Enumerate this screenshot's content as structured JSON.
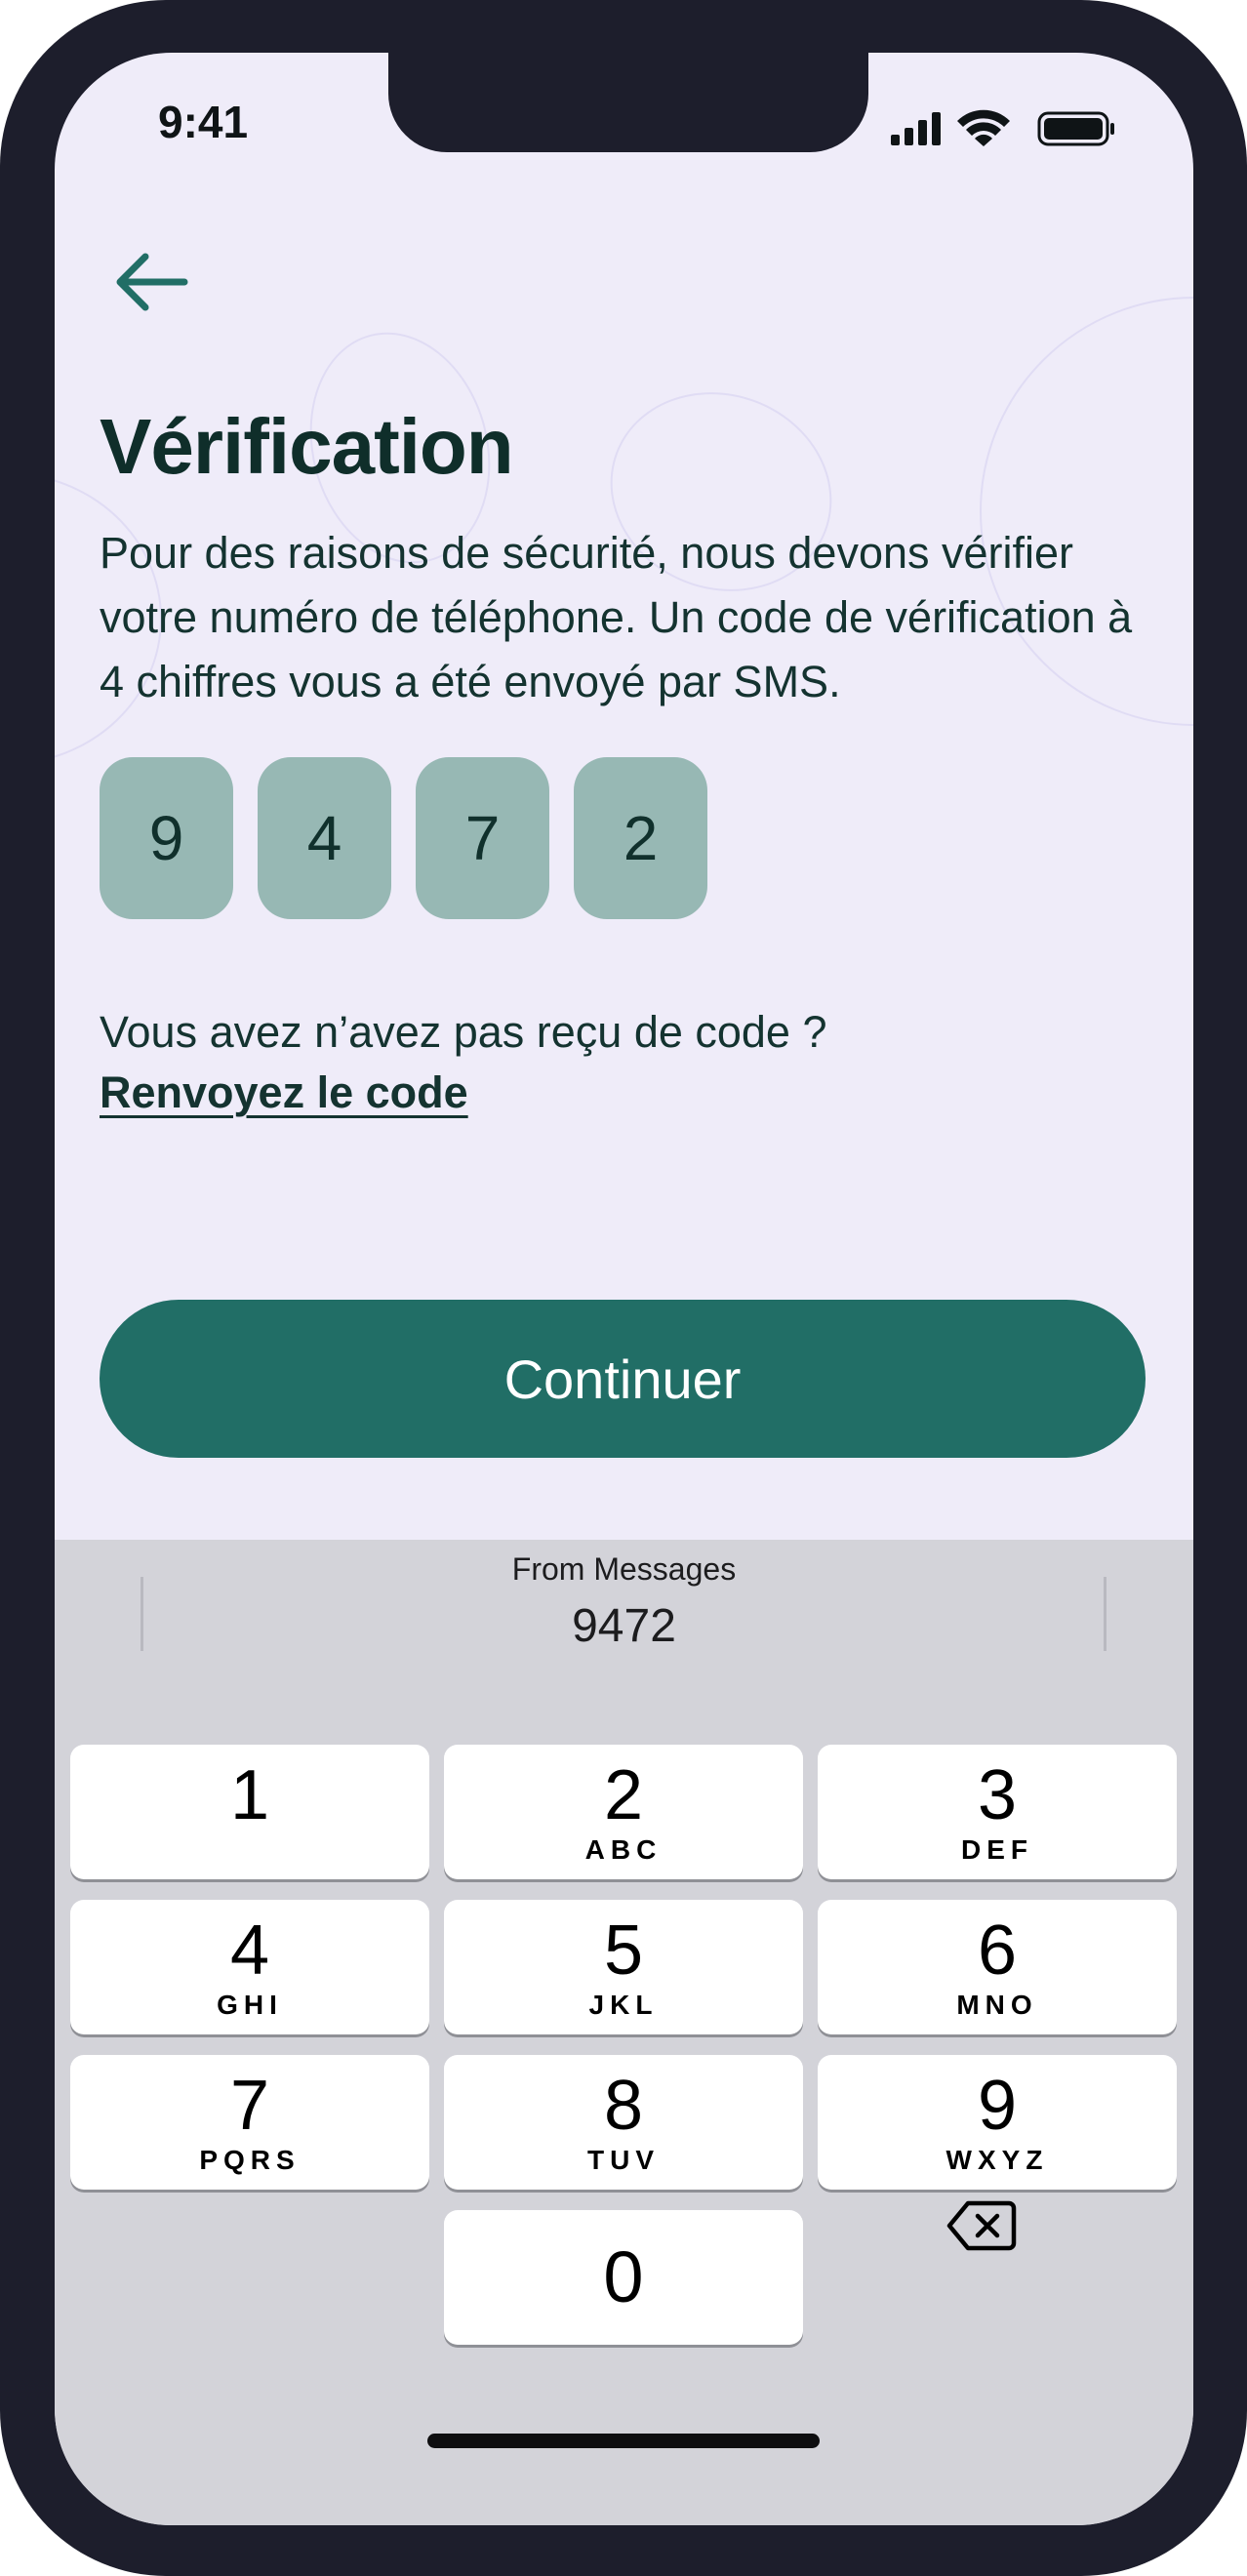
{
  "status_bar": {
    "time": "9:41",
    "icons": [
      "cellular-signal-icon",
      "wifi-icon",
      "battery-icon"
    ]
  },
  "header": {
    "back_icon": "arrow-left-icon"
  },
  "main": {
    "title": "Vérification",
    "description": "Pour des raisons de sécurité, nous devons vérifier votre numéro de téléphone. Un code de vérification à 4 chiffres vous a été envoyé par SMS.",
    "otp_digits": [
      "9",
      "4",
      "7",
      "2"
    ],
    "resend_question": "Vous avez n’avez pas reçu de code ?",
    "resend_link": "Renvoyez le code",
    "continue_label": "Continuer"
  },
  "keyboard": {
    "suggestion_source": "From Messages",
    "suggestion_value": "9472",
    "keys": [
      {
        "num": "1",
        "letters": ""
      },
      {
        "num": "2",
        "letters": "ABC"
      },
      {
        "num": "3",
        "letters": "DEF"
      },
      {
        "num": "4",
        "letters": "GHI"
      },
      {
        "num": "5",
        "letters": "JKL"
      },
      {
        "num": "6",
        "letters": "MNO"
      },
      {
        "num": "7",
        "letters": "PQRS"
      },
      {
        "num": "8",
        "letters": "TUV"
      },
      {
        "num": "9",
        "letters": "WXYZ"
      },
      {
        "num": "0",
        "letters": ""
      }
    ],
    "backspace_icon": "backspace-icon"
  },
  "colors": {
    "primary": "#216e66",
    "otp_box": "#97b8b4",
    "background": "#efecf9",
    "keyboard_bg": "#d3d3d9",
    "heading": "#0f2e2a"
  }
}
